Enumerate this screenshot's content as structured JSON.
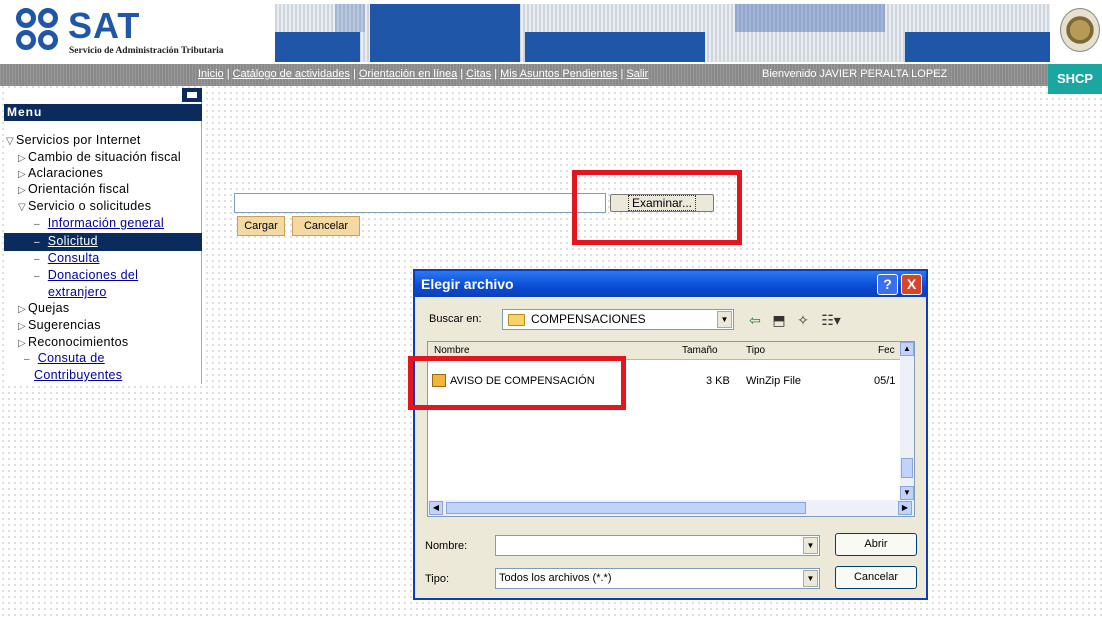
{
  "header": {
    "logo_text": "SAT",
    "logo_subtitle": "Servicio de Administración Tributaria",
    "shcp_label": "SHCP"
  },
  "nav": {
    "links": [
      "Inicio",
      "Catálogo de actividades",
      "Orientación en línea",
      "Citas",
      "Mis Asuntos Pendientes",
      "Salir"
    ],
    "welcome": "Bienvenido JAVIER PERALTA LOPEZ"
  },
  "sidebar": {
    "menu_title": "Menu",
    "items": [
      {
        "label": "Servicios por Internet"
      },
      {
        "label": "Cambio de situación fiscal"
      },
      {
        "label": "Aclaraciones"
      },
      {
        "label": "Orientación fiscal"
      },
      {
        "label": "Servicio o solicitudes"
      },
      {
        "label": "Información general"
      },
      {
        "label": "Solicitud"
      },
      {
        "label": "Consulta"
      },
      {
        "label": "Donaciones del"
      },
      {
        "label": "extranjero"
      },
      {
        "label": "Quejas"
      },
      {
        "label": "Sugerencias"
      },
      {
        "label": "Reconocimientos"
      },
      {
        "label": "Consuta de"
      },
      {
        "label": "Contribuyentes"
      }
    ]
  },
  "upload": {
    "file_value": "",
    "browse_label": "Examinar...",
    "load_label": "Cargar",
    "cancel_label": "Cancelar"
  },
  "dialog": {
    "title": "Elegir archivo",
    "help": "?",
    "close": "X",
    "lookin_label": "Buscar en:",
    "lookin_value": "COMPENSACIONES",
    "columns": {
      "name": "Nombre",
      "size": "Tamaño",
      "type": "Tipo",
      "date": "Fec"
    },
    "file": {
      "name": "AVISO DE COMPENSACIÓN",
      "size": "3 KB",
      "type": "WinZip File",
      "date": "05/1"
    },
    "filename_label": "Nombre:",
    "filename_value": "",
    "filetype_label": "Tipo:",
    "filetype_value": "Todos los archivos (*.*)",
    "open_label": "Abrir",
    "cancel_label": "Cancelar"
  },
  "colors": {
    "brand_blue": "#1f56a8",
    "menu_navy": "#0b2b5c",
    "highlight_red": "#e3161f",
    "shcp_teal": "#1aa7a0"
  }
}
